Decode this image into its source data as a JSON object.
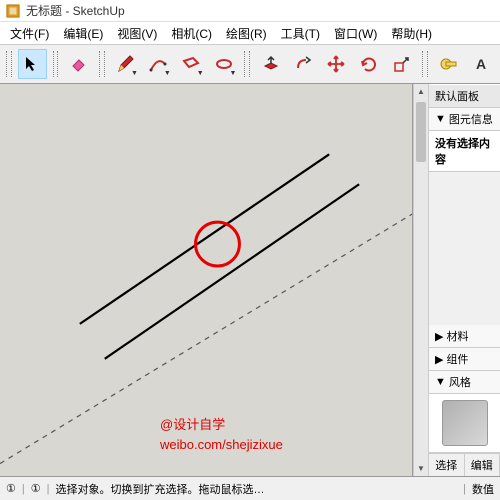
{
  "window": {
    "title": "无标题 - SketchUp"
  },
  "menu": {
    "file": "文件(F)",
    "edit": "编辑(E)",
    "view": "视图(V)",
    "camera": "相机(C)",
    "draw": "绘图(R)",
    "tools": "工具(T)",
    "window": "窗口(W)",
    "help": "帮助(H)"
  },
  "side": {
    "default_panel": "默认面板",
    "entity_info": "图元信息",
    "no_selection": "没有选择内容",
    "materials": "材料",
    "components": "组件",
    "styles": "风格",
    "tab_select": "选择",
    "tab_edit": "编辑"
  },
  "status": {
    "ring1": "①",
    "sep": "|",
    "ring2": "①",
    "msg": "选择对象。切换到扩充选择。拖动鼠标选…",
    "value_label": "数值"
  },
  "watermark": {
    "line1": "@设计自学",
    "line2": "weibo.com/shejizixue"
  },
  "colors": {
    "eraser": "#e85a9b",
    "pencil": "#c92a2a",
    "arc": "#c92a2a",
    "move": "#c92a2a",
    "orbit": "#c92a2a"
  }
}
